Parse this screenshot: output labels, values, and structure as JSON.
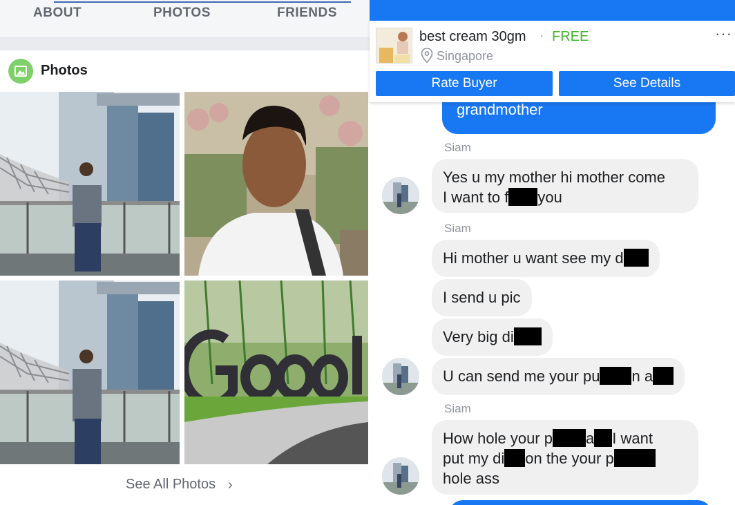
{
  "profile_tabs": [
    "ABOUT",
    "PHOTOS",
    "FRIENDS"
  ],
  "photos": {
    "title": "Photos",
    "see_all": "See All Photos"
  },
  "listing": {
    "title": "best cream 30gm",
    "separator": "·",
    "price": "FREE",
    "location": "Singapore",
    "more": "···",
    "rate_buyer": "Rate Buyer",
    "see_details": "See Details"
  },
  "chat": {
    "my_last": "grandmother",
    "sender_name": "Siam",
    "messages": [
      {
        "line1_a": "Yes u my mother hi mother come",
        "line2_a": "I want to f",
        "line2_b": "you"
      },
      {
        "a": "Hi mother u want see my d"
      },
      {
        "a": "I send u pic"
      },
      {
        "a": "Very big di"
      },
      {
        "a": "U can send me your pu",
        "b": "n a"
      },
      {
        "l1_a": "How hole your p",
        "l1_b": "a",
        "l1_c": "I want",
        "l2_a": "put my di",
        "l2_b": "on the your p",
        "l3": "hole ass"
      }
    ]
  },
  "colors": {
    "messenger_blue": "#1877f2",
    "free_green": "#42b72a",
    "fb_blue": "#4267b2"
  }
}
